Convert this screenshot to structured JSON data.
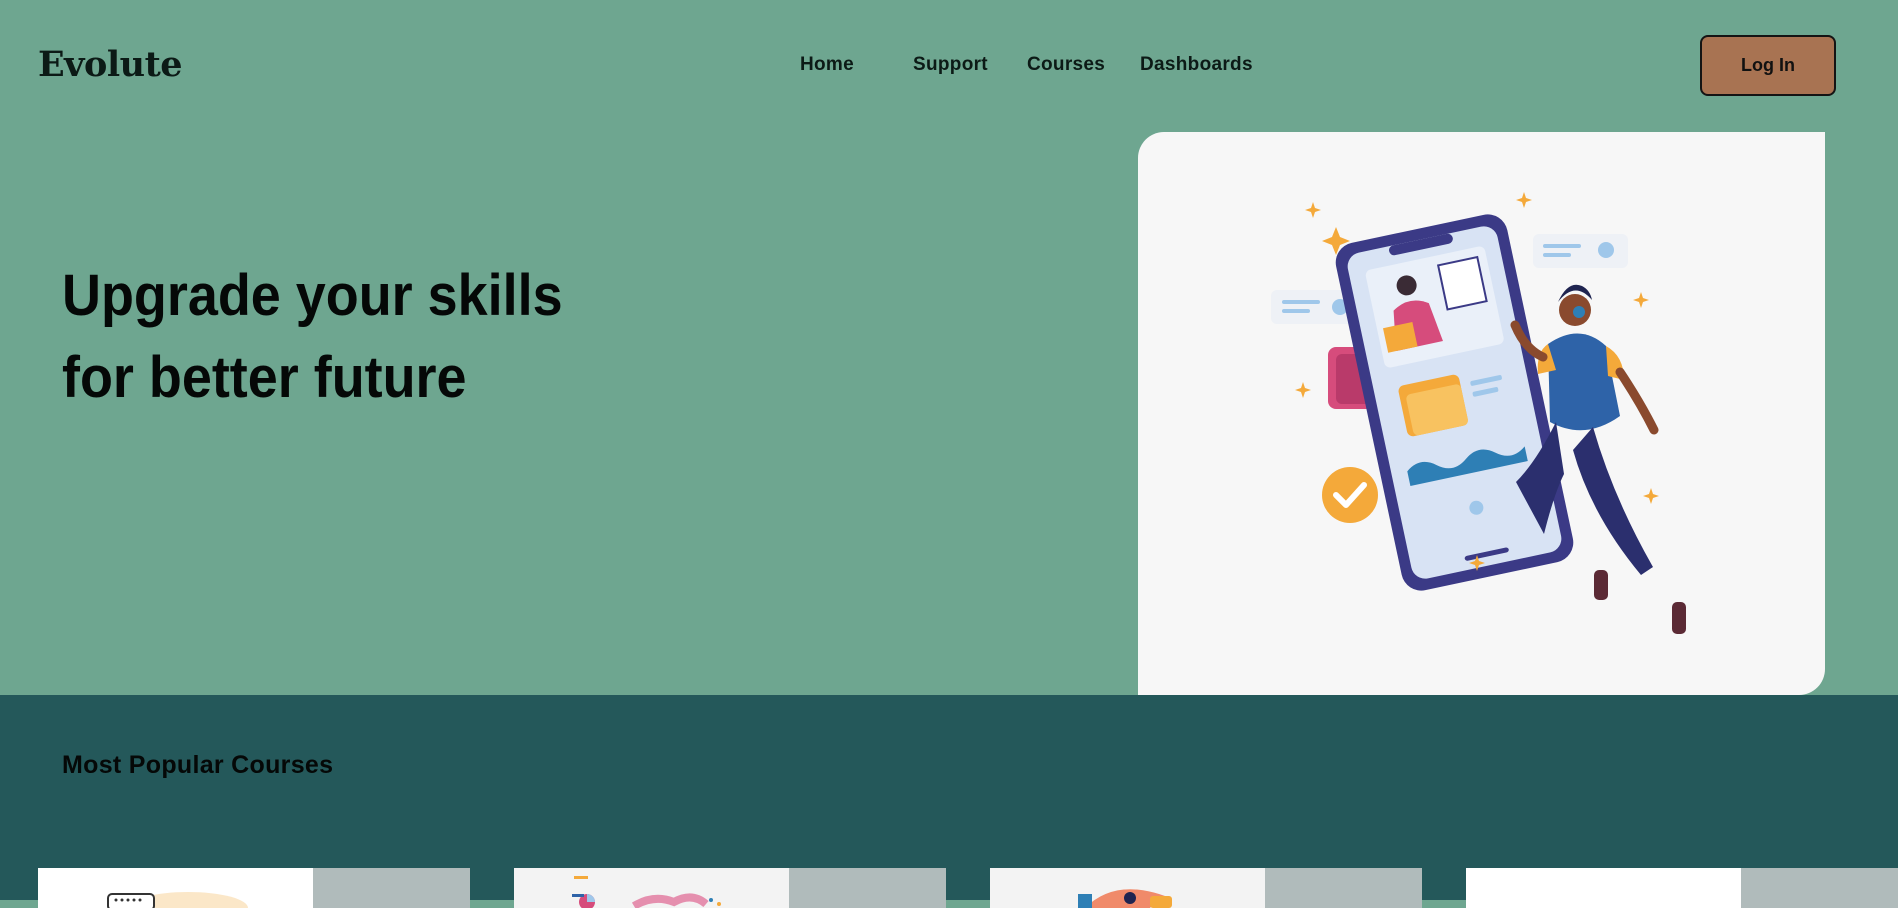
{
  "brand": {
    "name": "Evolute"
  },
  "nav": {
    "items": [
      {
        "label": "Home"
      },
      {
        "label": "Support"
      },
      {
        "label": "Courses"
      },
      {
        "label": "Dashboards"
      }
    ],
    "login_label": "Log In"
  },
  "hero": {
    "title_line1": "Upgrade your skills",
    "title_line2": "for better future",
    "illustration": "person-with-phone-learning-illustration"
  },
  "popular": {
    "title": "Most Popular Courses",
    "cards": [
      {
        "thumbnail": "course-thumbnail-1"
      },
      {
        "thumbnail": "course-thumbnail-2"
      },
      {
        "thumbnail": "course-thumbnail-3"
      },
      {
        "thumbnail": "course-thumbnail-4"
      }
    ]
  },
  "colors": {
    "hero_bg": "#6ea690",
    "section_bg": "#24585a",
    "login_button": "#a87352",
    "card_bg": "#f7f7f7",
    "accent_orange": "#f4a93a",
    "accent_purple": "#3b3a86"
  }
}
